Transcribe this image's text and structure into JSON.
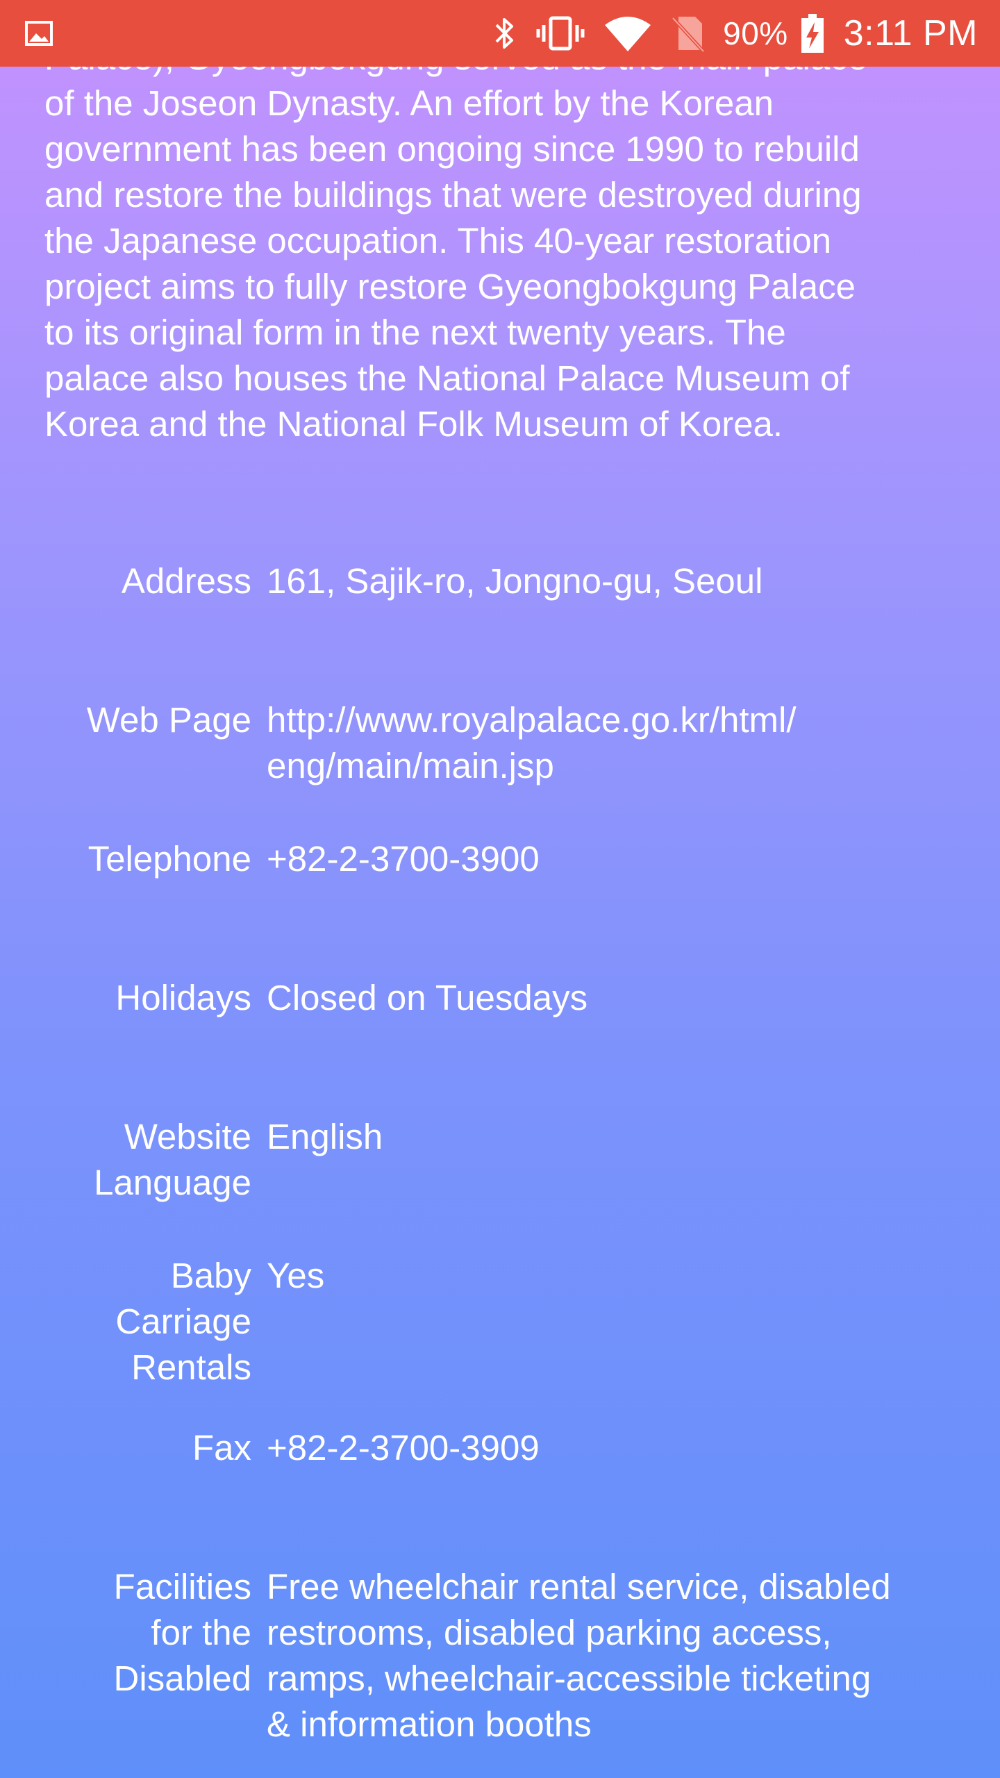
{
  "status_bar": {
    "time": "3:11 PM",
    "battery_percent": "90%",
    "icons": [
      "image-notification-icon",
      "bluetooth-icon",
      "vibrate-icon",
      "wifi-icon",
      "no-sim-icon",
      "battery-charging-icon"
    ],
    "background_color": "#e84e3e"
  },
  "description": {
    "lines": [
      "Palace), Gyeongbokgung served as the main palace",
      "of the Joseon Dynasty.   An effort by the Korean",
      "government has been ongoing since 1990 to rebuild",
      "and restore the buildings that were destroyed during",
      "the Japanese occupation. This 40-year restoration",
      "project aims to fully restore Gyeongbokgung Palace",
      "to its original form in the next twenty years. The",
      "palace also houses the National Palace Museum of",
      "Korea and the National Folk Museum of Korea."
    ]
  },
  "info": [
    {
      "label_lines": [
        "Address"
      ],
      "value_lines": [
        "161, Sajik-ro, Jongno-gu, Seoul"
      ]
    },
    {
      "label_lines": [
        "Web Page"
      ],
      "value_lines": [
        "http://www.royalpalace.go.kr/html/",
        "eng/main/main.jsp"
      ]
    },
    {
      "label_lines": [
        "Telephone"
      ],
      "value_lines": [
        "+82-2-3700-3900"
      ]
    },
    {
      "label_lines": [
        "Holidays"
      ],
      "value_lines": [
        "Closed on Tuesdays"
      ]
    },
    {
      "label_lines": [
        "Website",
        "Language"
      ],
      "value_lines": [
        "English"
      ]
    },
    {
      "label_lines": [
        "Baby",
        "Carriage",
        "Rentals"
      ],
      "value_lines": [
        "Yes"
      ]
    },
    {
      "label_lines": [
        "Fax"
      ],
      "value_lines": [
        "+82-2-3700-3909"
      ]
    },
    {
      "label_lines": [
        "Facilities",
        "for the",
        "Disabled"
      ],
      "value_lines": [
        "Free wheelchair rental service, disabled",
        "restrooms, disabled parking access,",
        "ramps, wheelchair-accessible ticketing",
        "& information booths"
      ]
    }
  ],
  "colors": {
    "gradient_top": "#c592fe",
    "gradient_bottom": "#5f8ffa",
    "text": "#ffffff"
  }
}
